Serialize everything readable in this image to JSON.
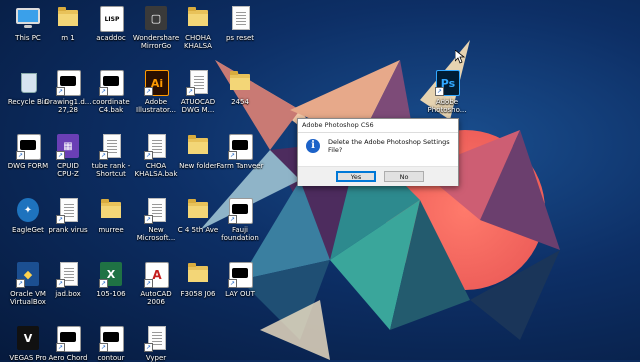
{
  "desktop": {
    "icons": [
      {
        "label": "This PC",
        "icon": "this-pc-icon",
        "kind": "monitor"
      },
      {
        "label": "m 1",
        "icon": "folder-icon",
        "kind": "folder"
      },
      {
        "label": "acaddoc",
        "icon": "lisp-file-icon",
        "kind": "lsp"
      },
      {
        "label": "Wondershare\nMirrorGo",
        "icon": "mirrorgo-icon",
        "kind": "mirrorgo"
      },
      {
        "label": "CHOHA\nKHALSA",
        "icon": "folder-icon",
        "kind": "folder"
      },
      {
        "label": "ps reset",
        "icon": "text-file-icon",
        "kind": "doc"
      },
      {
        "label": "Recycle Bin",
        "icon": "recycle-bin-icon",
        "kind": "bin"
      },
      {
        "label": "Drawing1.d...\n27,28",
        "icon": "drawing-file-icon",
        "kind": "whitedoc"
      },
      {
        "label": "coordinate\nC4.bak",
        "icon": "bak-file-icon",
        "kind": "whitedoc"
      },
      {
        "label": "Adobe\nIllustrator...",
        "icon": "illustrator-icon",
        "kind": "ai"
      },
      {
        "label": "ATUOCAD\nDWG M...",
        "icon": "text-file-icon",
        "kind": "doc"
      },
      {
        "label": "2454",
        "icon": "folder-icon",
        "kind": "folder"
      },
      {
        "label": "DWG FORM",
        "icon": "drawing-file-icon",
        "kind": "whitedoc"
      },
      {
        "label": "CPUID\nCPU-Z",
        "icon": "cpuz-icon",
        "kind": "cpuz"
      },
      {
        "label": "tube rank -\nShortcut",
        "icon": "text-file-icon",
        "kind": "doc"
      },
      {
        "label": "CHOA\nKHALSA.bak",
        "icon": "text-file-icon",
        "kind": "doc"
      },
      {
        "label": "New folder",
        "icon": "folder-icon",
        "kind": "folder"
      },
      {
        "label": "Farm Tanveer",
        "icon": "image-file-icon",
        "kind": "whitedoc"
      },
      {
        "label": "EagleGet",
        "icon": "eagleget-icon",
        "kind": "eagle"
      },
      {
        "label": "prank virus",
        "icon": "text-file-icon",
        "kind": "doc"
      },
      {
        "label": "murree",
        "icon": "folder-icon",
        "kind": "folder"
      },
      {
        "label": "New\nMicrosoft...",
        "icon": "text-file-icon",
        "kind": "doc"
      },
      {
        "label": "C 4 5th Ave",
        "icon": "folder-icon",
        "kind": "folder"
      },
      {
        "label": "Fauji\nfoundation",
        "icon": "drawing-file-icon",
        "kind": "whitedoc"
      },
      {
        "label": "Oracle VM\nVirtualBox",
        "icon": "virtualbox-icon",
        "kind": "vbox"
      },
      {
        "label": "jad.box",
        "icon": "text-file-icon",
        "kind": "doc"
      },
      {
        "label": "105-106",
        "icon": "excel-icon",
        "kind": "excel"
      },
      {
        "label": "AutoCAD\n2006",
        "icon": "autocad-icon",
        "kind": "autocad"
      },
      {
        "label": "F3058 J06",
        "icon": "folder-icon",
        "kind": "folder"
      },
      {
        "label": "LAY OUT",
        "icon": "drawing-file-icon",
        "kind": "whitedoc"
      },
      {
        "label": "VEGAS Pro",
        "icon": "vegas-icon",
        "kind": "vegas"
      },
      {
        "label": "Aero Chord",
        "icon": "audio-file-icon",
        "kind": "whitedoc"
      },
      {
        "label": "contour",
        "icon": "drawing-file-icon",
        "kind": "whitedoc"
      },
      {
        "label": "Vyper",
        "icon": "app-icon",
        "kind": "doc"
      },
      {
        "label": "Adobe\nPhotosho...",
        "icon": "photoshop-icon",
        "kind": "ps"
      }
    ]
  },
  "dialog": {
    "title": "Adobe Photoshop CS6",
    "message": "Delete the Adobe Photoshop Settings File?",
    "yes_label": "Yes",
    "no_label": "No"
  },
  "colors": {
    "desktop_bg": "#0d2f66",
    "accent": "#0078d7",
    "info_icon": "#1c62c8"
  }
}
